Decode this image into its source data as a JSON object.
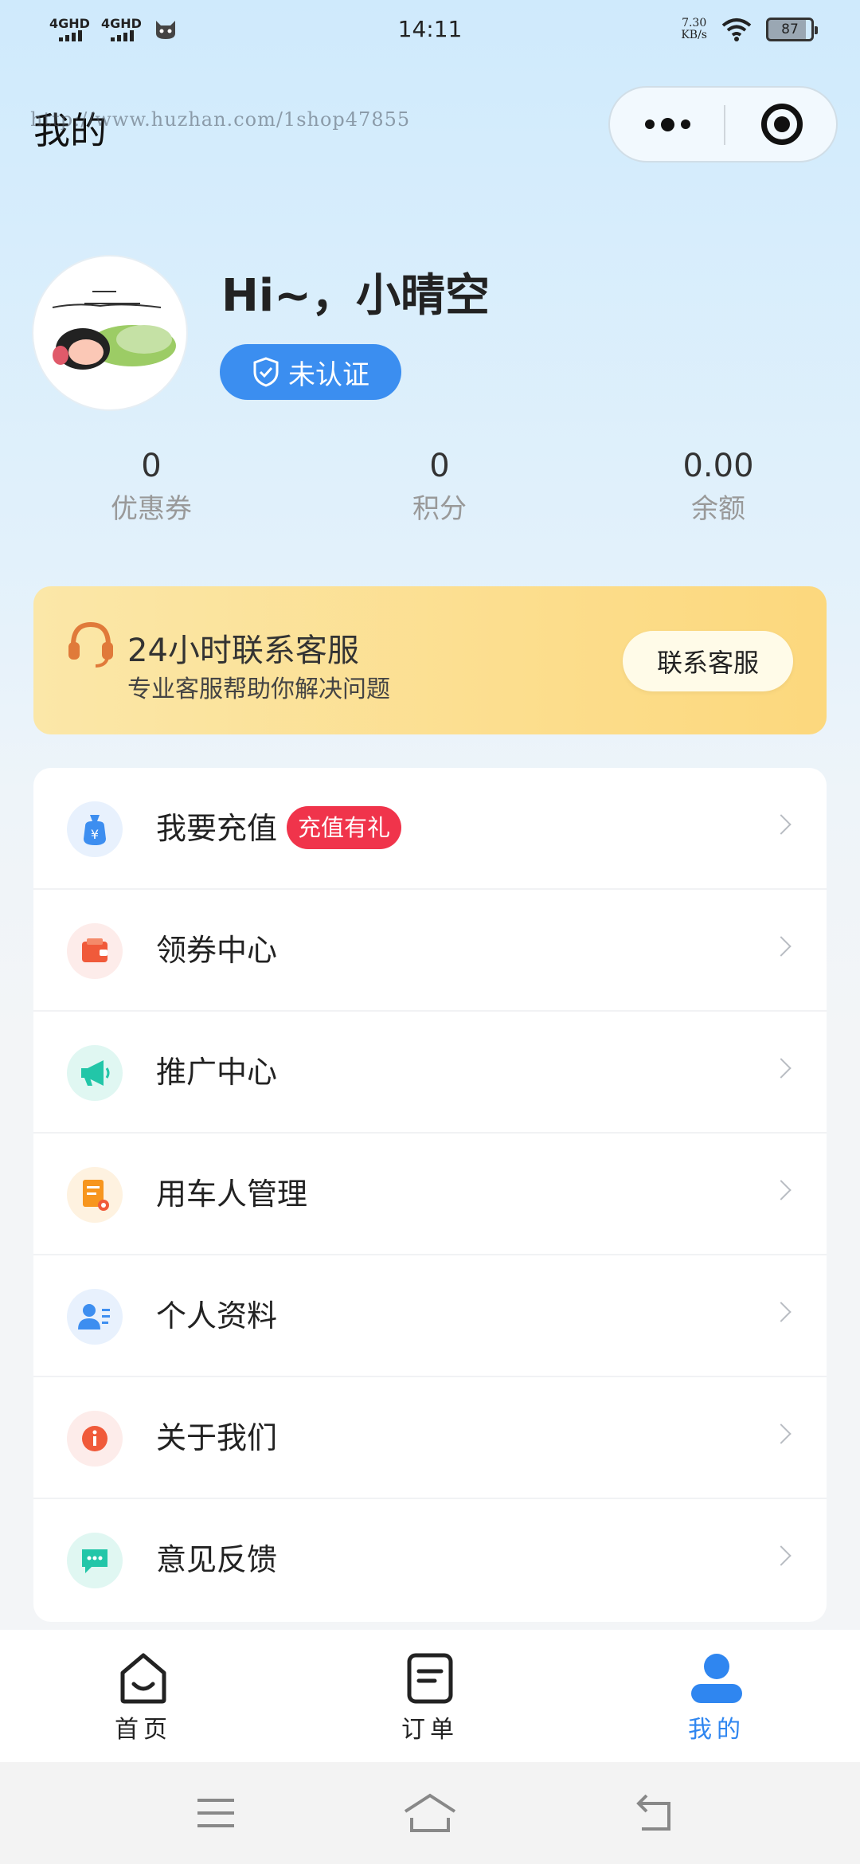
{
  "status_bar": {
    "sim1": "4GHD",
    "sim2": "4GHD",
    "time": "14:11",
    "net_speed_value": "7.30",
    "net_speed_unit": "KB/s",
    "battery": "87"
  },
  "header": {
    "title": "我的",
    "watermark": "http://www.huzhan.com/1shop47855"
  },
  "profile": {
    "greeting": "Hi~，小晴空",
    "verify_status": "未认证"
  },
  "stats": [
    {
      "value": "0",
      "label": "优惠券"
    },
    {
      "value": "0",
      "label": "积分"
    },
    {
      "value": "0.00",
      "label": "余额"
    }
  ],
  "service": {
    "title": "24小时联系客服",
    "subtitle": "专业客服帮助你解决问题",
    "button": "联系客服"
  },
  "menu": [
    {
      "label": "我要充值",
      "tag": "充值有礼",
      "icon": "money-bag-icon",
      "color": "#3d8ef0"
    },
    {
      "label": "领券中心",
      "icon": "wallet-icon",
      "color": "#f05a3a"
    },
    {
      "label": "推广中心",
      "icon": "megaphone-icon",
      "color": "#22c6a8"
    },
    {
      "label": "用车人管理",
      "icon": "document-icon",
      "color": "#f7961e"
    },
    {
      "label": "个人资料",
      "icon": "user-card-icon",
      "color": "#3d8ef0"
    },
    {
      "label": "关于我们",
      "icon": "info-icon",
      "color": "#f05a3a"
    },
    {
      "label": "意见反馈",
      "icon": "chat-icon",
      "color": "#22c6a8"
    }
  ],
  "tabs": [
    {
      "label": "首页",
      "icon": "home-icon"
    },
    {
      "label": "订单",
      "icon": "order-icon"
    },
    {
      "label": "我的",
      "icon": "user-icon",
      "active": true
    }
  ],
  "colors": {
    "accent": "#2f86f0",
    "tag_red": "#f0344b",
    "banner_yellow": "#fcd87d"
  }
}
